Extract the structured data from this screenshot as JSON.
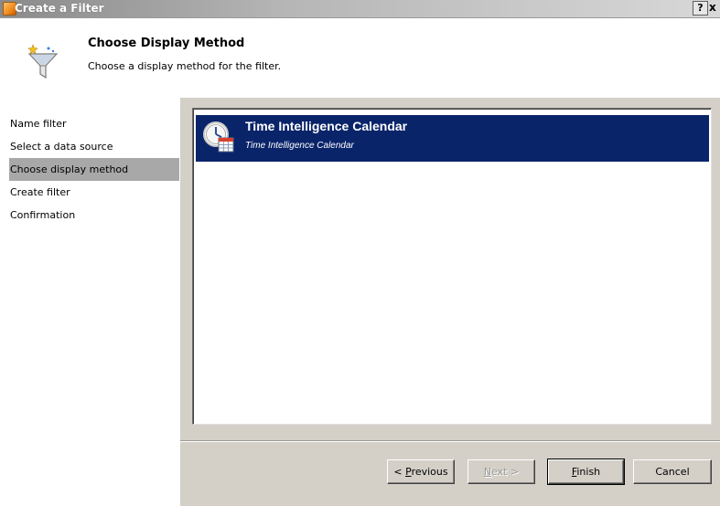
{
  "window": {
    "title": "Create a Filter",
    "help_label": "?",
    "close_label": "x"
  },
  "header": {
    "title": "Choose Display Method",
    "subtitle": "Choose a display method for the filter."
  },
  "steps": [
    {
      "label": "Name filter",
      "active": false
    },
    {
      "label": "Select a data source",
      "active": false
    },
    {
      "label": "Choose display method",
      "active": true
    },
    {
      "label": "Create filter",
      "active": false
    },
    {
      "label": "Confirmation",
      "active": false
    }
  ],
  "display_methods": [
    {
      "title": "Time Intelligence Calendar",
      "description": "Time Intelligence Calendar",
      "selected": true,
      "icon": "calendar-clock-icon"
    }
  ],
  "buttons": {
    "previous": {
      "pre": "< ",
      "mnemonic": "P",
      "post": "revious"
    },
    "next": {
      "mnemonic": "N",
      "post": "ext >"
    },
    "finish": {
      "mnemonic": "F",
      "post": "inish"
    },
    "cancel": {
      "label": "Cancel"
    }
  },
  "colors": {
    "selection": "#0a246a",
    "active_step": "#a8a8a8",
    "panel": "#d4d0c8"
  }
}
